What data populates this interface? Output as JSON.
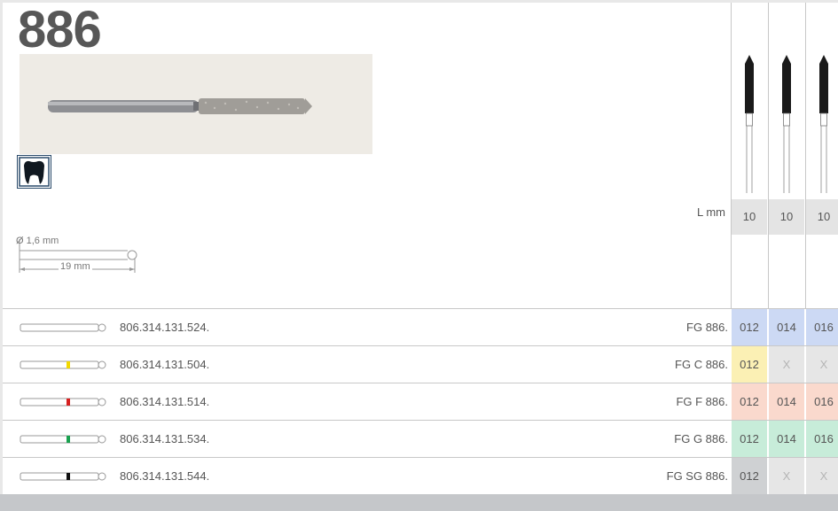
{
  "product": {
    "number": "886",
    "dimensions": {
      "diameter": "Ø 1,6 mm",
      "length": "19 mm"
    }
  },
  "length_label": "L mm",
  "sizes": [
    {
      "length": "10"
    },
    {
      "length": "10"
    },
    {
      "length": "10"
    }
  ],
  "colors": {
    "bottom_bar": "#c5c7ca",
    "length_cell": "#e4e4e4",
    "blue": "#ccd9f4",
    "yellow": "#fbf0b4",
    "red": "#fad9cd",
    "green": "#c7ecd9",
    "gray": "#cfd1d3",
    "unavailable": "#e6e6e6"
  },
  "rows": [
    {
      "ref": "806.314.131.524.",
      "designation": "FG 886.",
      "band_color": "none",
      "cells": [
        {
          "value": "012",
          "fill": "#ccd9f4"
        },
        {
          "value": "014",
          "fill": "#ccd9f4"
        },
        {
          "value": "016",
          "fill": "#ccd9f4"
        }
      ]
    },
    {
      "ref": "806.314.131.504.",
      "designation": "FG C 886.",
      "band_color": "#f2d800",
      "cells": [
        {
          "value": "012",
          "fill": "#fbf0b4"
        },
        {
          "value": "X",
          "fill": "#e6e6e6"
        },
        {
          "value": "X",
          "fill": "#e6e6e6"
        }
      ]
    },
    {
      "ref": "806.314.131.514.",
      "designation": "FG F 886.",
      "band_color": "#d62020",
      "cells": [
        {
          "value": "012",
          "fill": "#fad9cd"
        },
        {
          "value": "014",
          "fill": "#fad9cd"
        },
        {
          "value": "016",
          "fill": "#fad9cd"
        }
      ]
    },
    {
      "ref": "806.314.131.534.",
      "designation": "FG G 886.",
      "band_color": "#1aa150",
      "cells": [
        {
          "value": "012",
          "fill": "#c7ecd9"
        },
        {
          "value": "014",
          "fill": "#c7ecd9"
        },
        {
          "value": "016",
          "fill": "#c7ecd9"
        }
      ]
    },
    {
      "ref": "806.314.131.544.",
      "designation": "FG SG 886.",
      "band_color": "#111111",
      "cells": [
        {
          "value": "012",
          "fill": "#cfd1d3"
        },
        {
          "value": "X",
          "fill": "#e6e6e6"
        },
        {
          "value": "X",
          "fill": "#e6e6e6"
        }
      ]
    }
  ],
  "icons": {
    "tooth": "tooth-crown-icon",
    "bur_product": "diamond-bur-photo",
    "bur_size": "bur-silhouette-icon",
    "bur_row": "bur-outline-icon"
  }
}
